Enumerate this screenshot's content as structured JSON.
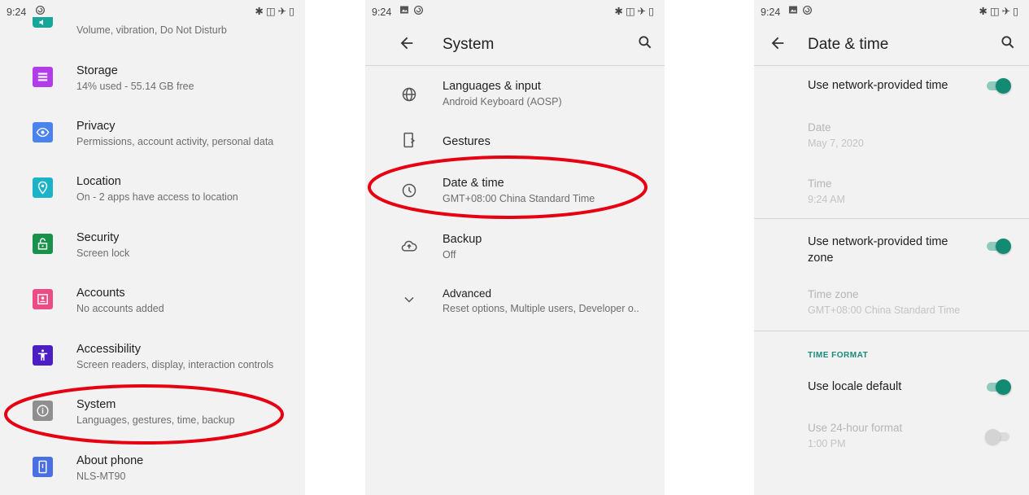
{
  "screens": {
    "settings": {
      "status_time": "9:24",
      "items": [
        {
          "sub": "Volume, vibration, Do Not Disturb",
          "icon": "sound-icon",
          "color": "#16a79a"
        },
        {
          "title": "Storage",
          "sub": "14% used - 55.14 GB free",
          "icon": "storage-icon",
          "color": "#b23cea"
        },
        {
          "title": "Privacy",
          "sub": "Permissions, account activity, personal data",
          "icon": "privacy-icon",
          "color": "#4a82ee"
        },
        {
          "title": "Location",
          "sub": "On - 2 apps have access to location",
          "icon": "location-icon",
          "color": "#1cb2c7"
        },
        {
          "title": "Security",
          "sub": "Screen lock",
          "icon": "lock-icon",
          "color": "#18924a"
        },
        {
          "title": "Accounts",
          "sub": "No accounts added",
          "icon": "accounts-icon",
          "color": "#ee4a84"
        },
        {
          "title": "Accessibility",
          "sub": "Screen readers, display, interaction controls",
          "icon": "accessibility-icon",
          "color": "#4b1fc4"
        },
        {
          "title": "System",
          "sub": "Languages, gestures, time, backup",
          "icon": "info-icon",
          "color": "#8f8f8f"
        },
        {
          "title": "About phone",
          "sub": "NLS-MT90",
          "icon": "phone-icon",
          "color": "#4a6fe2"
        }
      ]
    },
    "system": {
      "status_time": "9:24",
      "title": "System",
      "items": [
        {
          "title": "Languages & input",
          "sub": "Android Keyboard (AOSP)",
          "icon": "globe-icon"
        },
        {
          "title": "Gestures",
          "sub": "",
          "icon": "gestures-icon"
        },
        {
          "title": "Date & time",
          "sub": "GMT+08:00 China Standard Time",
          "icon": "clock-icon"
        },
        {
          "title": "Backup",
          "sub": "Off",
          "icon": "cloud-upload-icon"
        },
        {
          "title": "Advanced",
          "sub": "Reset options, Multiple users, Developer o..",
          "icon": "chevron-down-icon"
        }
      ]
    },
    "datetime": {
      "status_time": "9:24",
      "title": "Date & time",
      "network_time": {
        "label": "Use network-provided time",
        "on": true
      },
      "date": {
        "label": "Date",
        "value": "May 7, 2020"
      },
      "time": {
        "label": "Time",
        "value": "9:24 AM"
      },
      "network_zone": {
        "label": "Use network-provided time zone",
        "on": true
      },
      "time_zone": {
        "label": "Time zone",
        "value": "GMT+08:00 China Standard Time"
      },
      "section_header": "TIME FORMAT",
      "locale_default": {
        "label": "Use locale default",
        "on": true
      },
      "format_24": {
        "label": "Use 24-hour format",
        "value": "1:00 PM",
        "on": false
      }
    }
  },
  "annotation_color": "#e60012"
}
